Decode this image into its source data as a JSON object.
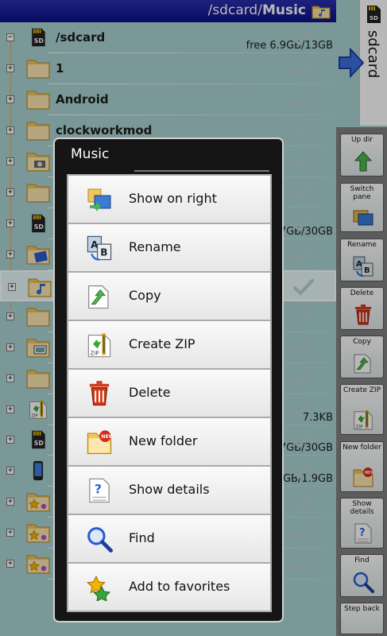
{
  "header": {
    "path_prefix": "/sdcard/",
    "path_current": "Music"
  },
  "tree": {
    "rows": [
      {
        "name": "/sdcard",
        "sub": "free 6.9GB/13GB",
        "icon": "sdcard-icon",
        "expander": "−"
      },
      {
        "name": "1",
        "sub": "",
        "icon": "folder-icon",
        "expander": "+"
      },
      {
        "name": "Android",
        "sub": "",
        "icon": "folder-icon",
        "expander": "+"
      },
      {
        "name": "clockworkmod",
        "sub": "",
        "icon": "folder-icon",
        "expander": "+"
      },
      {
        "name": "",
        "sub": "",
        "icon": "folder-camera-icon",
        "expander": "+"
      },
      {
        "name": "",
        "sub": "",
        "icon": "folder-icon",
        "expander": "+"
      },
      {
        "name": "",
        "sub": "7GB/30GB",
        "icon": "sdcard-icon",
        "expander": "+"
      },
      {
        "name": "",
        "sub": "",
        "icon": "folder-video-icon",
        "expander": "+"
      },
      {
        "name": "",
        "sub": "",
        "icon": "folder-music-icon",
        "expander": "+",
        "selected": true
      },
      {
        "name": "",
        "sub": "",
        "icon": "folder-icon",
        "expander": "+"
      },
      {
        "name": "",
        "sub": "",
        "icon": "folder-image-icon",
        "expander": "+"
      },
      {
        "name": "",
        "sub": "",
        "icon": "folder-icon",
        "expander": "+"
      },
      {
        "name": "",
        "sub": "7.3KB",
        "icon": "zip-icon",
        "expander": "+"
      },
      {
        "name": "/",
        "sub": "7GB/30GB",
        "icon": "sdcard-icon",
        "expander": "+"
      },
      {
        "name": "/",
        "sub": "GB/1.9GB",
        "icon": "phone-icon",
        "expander": "+"
      },
      {
        "name": "/",
        "sub": "",
        "icon": "favorites-folder-icon",
        "expander": "+"
      },
      {
        "name": "/",
        "sub": "",
        "icon": "favorites-folder-icon",
        "expander": "+"
      },
      {
        "name": "/",
        "sub": "",
        "icon": "favorites-folder-icon",
        "expander": "+"
      }
    ]
  },
  "right_pane": {
    "tab_label": "sdcard"
  },
  "toolbar": {
    "buttons": [
      {
        "label": "Up dir",
        "icon": "up-arrow-icon"
      },
      {
        "label": "Switch pane",
        "icon": "switch-pane-icon"
      },
      {
        "label": "Rename",
        "icon": "rename-icon"
      },
      {
        "label": "Delete",
        "icon": "trash-icon"
      },
      {
        "label": "Copy",
        "icon": "copy-icon"
      },
      {
        "label": "Create ZIP",
        "icon": "zip-icon"
      },
      {
        "label": "New folder",
        "icon": "new-folder-icon"
      },
      {
        "label": "Show details",
        "icon": "details-icon"
      },
      {
        "label": "Find",
        "icon": "magnifier-icon"
      },
      {
        "label": "Step back",
        "icon": "back-icon"
      }
    ]
  },
  "dialog": {
    "title": "Music",
    "items": [
      {
        "label": "Show on right",
        "icon": "show-on-right-icon"
      },
      {
        "label": "Rename",
        "icon": "rename-icon"
      },
      {
        "label": "Copy",
        "icon": "copy-icon"
      },
      {
        "label": "Create ZIP",
        "icon": "zip-icon"
      },
      {
        "label": "Delete",
        "icon": "trash-icon"
      },
      {
        "label": "New folder",
        "icon": "new-folder-icon"
      },
      {
        "label": "Show details",
        "icon": "details-icon"
      },
      {
        "label": "Find",
        "icon": "magnifier-icon"
      },
      {
        "label": "Add to favorites",
        "icon": "star-icon"
      }
    ]
  },
  "colors": {
    "title_bar": "#0a0f86",
    "tree_background": "#a9d3d2",
    "toolbar_background": "#808080",
    "dialog_background": "#151515"
  }
}
